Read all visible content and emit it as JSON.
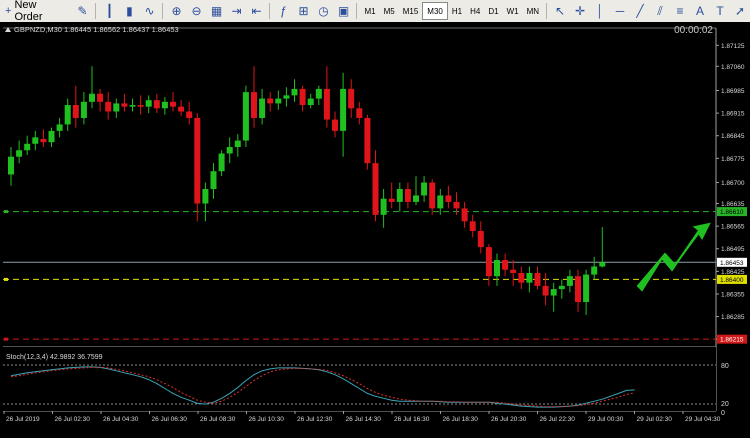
{
  "toolbar": {
    "new_order_label": "New Order",
    "timeframes": [
      "M1",
      "M5",
      "M15",
      "M30",
      "H1",
      "H4",
      "D1",
      "W1",
      "MN"
    ],
    "active_timeframe": "M30"
  },
  "chart": {
    "symbol_info": "GBPNZD,M30  1.86445 1.86562 1.86437 1.86453",
    "timer": "00:00:02",
    "price_ticks": [
      "1.87125",
      "1.87060",
      "1.86985",
      "1.86915",
      "1.86845",
      "1.86775",
      "1.86700",
      "1.86635",
      "1.86565",
      "1.86495",
      "1.86425",
      "1.86355",
      "1.86285",
      "1.86215"
    ],
    "price_tag_current": "1.86453",
    "price_tag_green": "1.86610",
    "price_tag_yellow": "1.86400",
    "price_tag_red": "1.86215",
    "stoch_label": "Stoch(12,3,4) 42.9892 36.7599",
    "stoch_ticks": [
      "80",
      "20",
      "0"
    ],
    "time_labels": [
      "26 Jul 2019",
      "26 Jul 02:30",
      "26 Jul 04:30",
      "26 Jul 06:30",
      "26 Jul 08:30",
      "26 Jul 10:30",
      "26 Jul 12:30",
      "26 Jul 14:30",
      "26 Jul 16:30",
      "26 Jul 18:30",
      "26 Jul 20:30",
      "26 Jul 22:30",
      "29 Jul 00:30",
      "29 Jul 02:30",
      "29 Jul 04:30"
    ],
    "colors": {
      "bull": "#21c021",
      "bear": "#e0151b",
      "main_line": "#3aa6b8",
      "signal_line": "#e03030",
      "green_level": "#28b428",
      "yellow_level": "#e0e000",
      "red_level": "#d01818",
      "arrow": "#20c020"
    }
  },
  "candles": [
    [
      1.86725,
      1.8681,
      1.8669,
      1.8678
    ],
    [
      1.8678,
      1.8683,
      1.8676,
      1.868
    ],
    [
      1.868,
      1.86845,
      1.86785,
      1.8682
    ],
    [
      1.8682,
      1.8686,
      1.868,
      1.8684
    ],
    [
      1.86835,
      1.86865,
      1.8681,
      1.86825
    ],
    [
      1.86825,
      1.8687,
      1.8681,
      1.8686
    ],
    [
      1.8686,
      1.869,
      1.8684,
      1.8688
    ],
    [
      1.8688,
      1.8696,
      1.8686,
      1.8694
    ],
    [
      1.8694,
      1.87,
      1.8687,
      1.869
    ],
    [
      1.869,
      1.8698,
      1.8688,
      1.8695
    ],
    [
      1.8695,
      1.8706,
      1.8693,
      1.86975
    ],
    [
      1.86975,
      1.8699,
      1.8692,
      1.8695
    ],
    [
      1.8695,
      1.8698,
      1.86895,
      1.8692
    ],
    [
      1.8692,
      1.8696,
      1.869,
      1.86945
    ],
    [
      1.86945,
      1.86975,
      1.8692,
      1.86935
    ],
    [
      1.86935,
      1.8696,
      1.8692,
      1.8694
    ],
    [
      1.8694,
      1.8697,
      1.8691,
      1.86935
    ],
    [
      1.86935,
      1.8697,
      1.86915,
      1.86955
    ],
    [
      1.86955,
      1.86975,
      1.86915,
      1.8693
    ],
    [
      1.8693,
      1.86965,
      1.8691,
      1.8695
    ],
    [
      1.8695,
      1.8698,
      1.8692,
      1.86935
    ],
    [
      1.86935,
      1.86955,
      1.86905,
      1.8692
    ],
    [
      1.8692,
      1.8695,
      1.8688,
      1.869
    ],
    [
      1.869,
      1.86915,
      1.8658,
      1.86635
    ],
    [
      1.86635,
      1.867,
      1.8658,
      1.8668
    ],
    [
      1.8668,
      1.8676,
      1.8665,
      1.86735
    ],
    [
      1.86735,
      1.868,
      1.8672,
      1.8679
    ],
    [
      1.8679,
      1.8684,
      1.8676,
      1.8681
    ],
    [
      1.8681,
      1.8685,
      1.8678,
      1.8683
    ],
    [
      1.8683,
      1.87,
      1.8681,
      1.8698
    ],
    [
      1.8698,
      1.8706,
      1.8687,
      1.869
    ],
    [
      1.869,
      1.8699,
      1.8688,
      1.8696
    ],
    [
      1.8696,
      1.8698,
      1.8692,
      1.86945
    ],
    [
      1.86945,
      1.86985,
      1.86925,
      1.8696
    ],
    [
      1.8696,
      1.86995,
      1.86935,
      1.8697
    ],
    [
      1.8697,
      1.8702,
      1.8695,
      1.8699
    ],
    [
      1.8699,
      1.87,
      1.8692,
      1.8694
    ],
    [
      1.8694,
      1.86975,
      1.8693,
      1.8696
    ],
    [
      1.8696,
      1.87,
      1.8694,
      1.8699
    ],
    [
      1.8699,
      1.8706,
      1.8687,
      1.86895
    ],
    [
      1.86895,
      1.8692,
      1.8684,
      1.8686
    ],
    [
      1.8686,
      1.8704,
      1.8678,
      1.8699
    ],
    [
      1.8699,
      1.8702,
      1.869,
      1.8693
    ],
    [
      1.8693,
      1.8695,
      1.8688,
      1.869
    ],
    [
      1.869,
      1.8691,
      1.8674,
      1.8676
    ],
    [
      1.8676,
      1.868,
      1.8658,
      1.866
    ],
    [
      1.866,
      1.8668,
      1.8656,
      1.8665
    ],
    [
      1.8665,
      1.867,
      1.8662,
      1.8664
    ],
    [
      1.8664,
      1.867,
      1.8661,
      1.8668
    ],
    [
      1.8668,
      1.867,
      1.8662,
      1.8664
    ],
    [
      1.8664,
      1.8672,
      1.8663,
      1.8666
    ],
    [
      1.8666,
      1.8672,
      1.8664,
      1.867
    ],
    [
      1.867,
      1.8671,
      1.866,
      1.8662
    ],
    [
      1.8662,
      1.8668,
      1.866,
      1.8666
    ],
    [
      1.8666,
      1.8669,
      1.8662,
      1.8664
    ],
    [
      1.8664,
      1.8667,
      1.866,
      1.8662
    ],
    [
      1.8662,
      1.8664,
      1.8656,
      1.8658
    ],
    [
      1.8658,
      1.866,
      1.8653,
      1.8655
    ],
    [
      1.8655,
      1.8658,
      1.8648,
      1.865
    ],
    [
      1.865,
      1.8651,
      1.8638,
      1.8641
    ],
    [
      1.8641,
      1.8648,
      1.8638,
      1.8646
    ],
    [
      1.8646,
      1.8648,
      1.8641,
      1.8643
    ],
    [
      1.8643,
      1.8646,
      1.8638,
      1.8642
    ],
    [
      1.8642,
      1.8644,
      1.8637,
      1.8639
    ],
    [
      1.8639,
      1.8644,
      1.8636,
      1.8642
    ],
    [
      1.8642,
      1.8644,
      1.8637,
      1.8638
    ],
    [
      1.8638,
      1.8642,
      1.8632,
      1.8635
    ],
    [
      1.8635,
      1.8639,
      1.863,
      1.8637
    ],
    [
      1.8637,
      1.864,
      1.8634,
      1.8638
    ],
    [
      1.8638,
      1.8643,
      1.8636,
      1.8641
    ],
    [
      1.8641,
      1.8643,
      1.863,
      1.8633
    ],
    [
      1.8633,
      1.8643,
      1.8629,
      1.86415
    ],
    [
      1.86415,
      1.8647,
      1.864,
      1.8644
    ],
    [
      1.8644,
      1.86562,
      1.86437,
      1.86453
    ]
  ],
  "stoch_main": [
    72,
    75,
    78,
    80,
    82,
    84,
    86,
    88,
    89,
    90,
    90,
    89,
    86,
    82,
    78,
    74,
    70,
    64,
    56,
    46,
    36,
    28,
    22,
    16,
    14,
    18,
    26,
    36,
    48,
    62,
    74,
    82,
    86,
    88,
    88,
    88,
    87,
    86,
    84,
    80,
    74,
    66,
    56,
    46,
    36,
    30,
    26,
    22,
    20,
    20,
    20,
    20,
    20,
    19,
    18,
    18,
    18,
    18,
    18,
    18,
    16,
    14,
    12,
    10,
    9,
    8,
    8,
    8,
    9,
    10,
    12,
    16,
    20,
    24,
    30,
    36,
    42,
    43
  ],
  "stoch_signal": [
    70,
    72,
    75,
    78,
    80,
    82,
    84,
    86,
    87,
    88,
    89,
    89,
    88,
    85,
    82,
    78,
    74,
    70,
    64,
    56,
    48,
    38,
    30,
    22,
    18,
    16,
    20,
    28,
    38,
    50,
    62,
    72,
    80,
    84,
    86,
    87,
    87,
    86,
    85,
    83,
    78,
    72,
    64,
    56,
    46,
    38,
    32,
    28,
    24,
    22,
    21,
    20,
    20,
    20,
    19,
    19,
    18,
    18,
    18,
    18,
    18,
    16,
    14,
    12,
    11,
    10,
    9,
    9,
    9,
    10,
    11,
    13,
    16,
    20,
    24,
    28,
    34,
    37
  ]
}
